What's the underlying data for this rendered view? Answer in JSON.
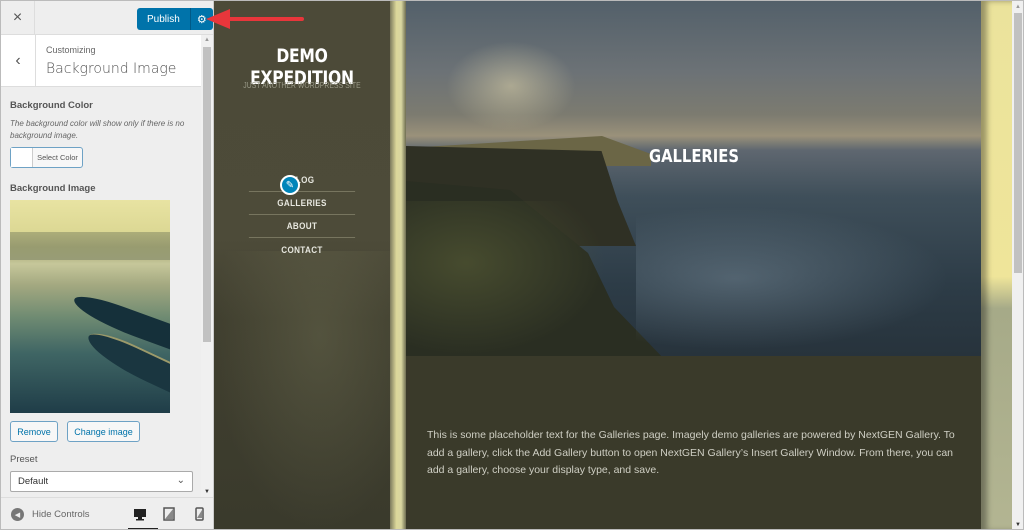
{
  "customizer": {
    "close_icon": "×",
    "publish_label": "Publish",
    "publish_gear_icon": "⚙",
    "back_icon": "‹",
    "breadcrumb": "Customizing",
    "section_title": "Background Image",
    "background_color": {
      "label": "Background Color",
      "description": "The background color will show only if there is no background image.",
      "select_label": "Select Color"
    },
    "background_image": {
      "label": "Background Image",
      "remove_label": "Remove",
      "change_label": "Change image"
    },
    "preset": {
      "label": "Preset",
      "value": "Default",
      "chevron_icon": "⌄"
    },
    "footer": {
      "hide_controls_label": "Hide Controls",
      "hide_icon": "◀",
      "devices": [
        "desktop",
        "tablet",
        "mobile"
      ],
      "active_device": "desktop"
    },
    "accent_color": "#0073aa"
  },
  "preview": {
    "site_title": "DEMO EXPEDITION",
    "tagline": "JUST ANOTHER WORDPRESS SITE",
    "nav": [
      {
        "label": "BLOG"
      },
      {
        "label": "GALLERIES"
      },
      {
        "label": "ABOUT"
      },
      {
        "label": "CONTACT"
      }
    ],
    "edit_icon": "✎",
    "page_title": "GALLERIES",
    "body_text": "This is some placeholder text for the Galleries page. Imagely demo galleries are powered by NextGEN Gallery. To add a gallery, click the Add Gallery button to open NextGEN Gallery’s Insert Gallery Window. From there, you can add a gallery, choose your display type, and save."
  },
  "annotation": {
    "arrow_color": "#e8363b"
  }
}
